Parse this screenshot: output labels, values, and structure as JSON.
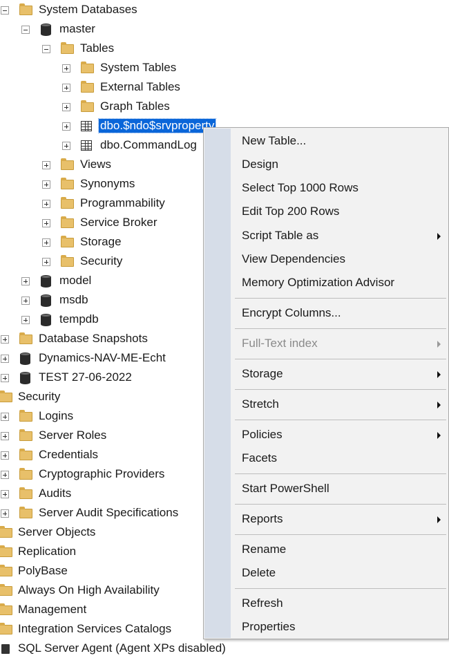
{
  "tree": {
    "nodes": [
      {
        "label": "System Databases",
        "icon": "folder-icon",
        "expander": "minus"
      },
      {
        "label": "master",
        "icon": "database-icon",
        "expander": "minus"
      },
      {
        "label": "Tables",
        "icon": "folder-icon",
        "expander": "minus"
      },
      {
        "label": "System Tables",
        "icon": "folder-icon",
        "expander": "plus"
      },
      {
        "label": "External Tables",
        "icon": "folder-icon",
        "expander": "plus"
      },
      {
        "label": "Graph Tables",
        "icon": "folder-icon",
        "expander": "plus"
      },
      {
        "label": "dbo.$ndo$srvproperty",
        "icon": "table-icon",
        "expander": "plus",
        "selected": true
      },
      {
        "label": "dbo.CommandLog",
        "icon": "table-icon",
        "expander": "plus"
      },
      {
        "label": "Views",
        "icon": "folder-icon",
        "expander": "plus"
      },
      {
        "label": "Synonyms",
        "icon": "folder-icon",
        "expander": "plus"
      },
      {
        "label": "Programmability",
        "icon": "folder-icon",
        "expander": "plus"
      },
      {
        "label": "Service Broker",
        "icon": "folder-icon",
        "expander": "plus"
      },
      {
        "label": "Storage",
        "icon": "folder-icon",
        "expander": "plus"
      },
      {
        "label": "Security",
        "icon": "folder-icon",
        "expander": "plus"
      },
      {
        "label": "model",
        "icon": "database-icon",
        "expander": "plus"
      },
      {
        "label": "msdb",
        "icon": "database-icon",
        "expander": "plus"
      },
      {
        "label": "tempdb",
        "icon": "database-icon",
        "expander": "plus"
      },
      {
        "label": "Database Snapshots",
        "icon": "folder-icon",
        "expander": "plus"
      },
      {
        "label": "Dynamics-NAV-ME-Echt",
        "icon": "database-icon",
        "expander": "plus"
      },
      {
        "label": "TEST 27-06-2022",
        "icon": "database-icon",
        "expander": "plus"
      },
      {
        "label": "Security",
        "icon": "folder-icon",
        "expander": "none"
      },
      {
        "label": "Logins",
        "icon": "folder-icon",
        "expander": "plus"
      },
      {
        "label": "Server Roles",
        "icon": "folder-icon",
        "expander": "plus"
      },
      {
        "label": "Credentials",
        "icon": "folder-icon",
        "expander": "plus"
      },
      {
        "label": "Cryptographic Providers",
        "icon": "folder-icon",
        "expander": "plus"
      },
      {
        "label": "Audits",
        "icon": "folder-icon",
        "expander": "plus"
      },
      {
        "label": "Server Audit Specifications",
        "icon": "folder-icon",
        "expander": "plus"
      },
      {
        "label": "Server Objects",
        "icon": "folder-icon",
        "expander": "none"
      },
      {
        "label": "Replication",
        "icon": "folder-icon",
        "expander": "none"
      },
      {
        "label": "PolyBase",
        "icon": "folder-icon",
        "expander": "none"
      },
      {
        "label": "Always On High Availability",
        "icon": "folder-icon",
        "expander": "none"
      },
      {
        "label": "Management",
        "icon": "folder-icon",
        "expander": "none"
      },
      {
        "label": "Integration Services Catalogs",
        "icon": "folder-icon",
        "expander": "none"
      },
      {
        "label": "SQL Server Agent (Agent XPs disabled)",
        "icon": "server-agent-icon",
        "expander": "none"
      }
    ]
  },
  "context_menu": {
    "items": [
      {
        "label": "New Table...",
        "submenu": false,
        "disabled": false
      },
      {
        "label": "Design",
        "submenu": false,
        "disabled": false
      },
      {
        "label": "Select Top 1000 Rows",
        "submenu": false,
        "disabled": false
      },
      {
        "label": "Edit Top 200 Rows",
        "submenu": false,
        "disabled": false
      },
      {
        "label": "Script Table as",
        "submenu": true,
        "disabled": false
      },
      {
        "label": "View Dependencies",
        "submenu": false,
        "disabled": false
      },
      {
        "label": "Memory Optimization Advisor",
        "submenu": false,
        "disabled": false
      },
      {
        "label": "Encrypt Columns...",
        "submenu": false,
        "disabled": false
      },
      {
        "label": "Full-Text index",
        "submenu": true,
        "disabled": true
      },
      {
        "label": "Storage",
        "submenu": true,
        "disabled": false
      },
      {
        "label": "Stretch",
        "submenu": true,
        "disabled": false
      },
      {
        "label": "Policies",
        "submenu": true,
        "disabled": false
      },
      {
        "label": "Facets",
        "submenu": false,
        "disabled": false
      },
      {
        "label": "Start PowerShell",
        "submenu": false,
        "disabled": false
      },
      {
        "label": "Reports",
        "submenu": true,
        "disabled": false
      },
      {
        "label": "Rename",
        "submenu": false,
        "disabled": false
      },
      {
        "label": "Delete",
        "submenu": false,
        "disabled": false
      },
      {
        "label": "Refresh",
        "submenu": false,
        "disabled": false
      },
      {
        "label": "Properties",
        "submenu": false,
        "disabled": false
      }
    ]
  },
  "colors": {
    "selection": "#0a66d9",
    "menu_background": "#f2f2f2",
    "menu_gutter": "#d6dde8",
    "folder": "#e8c06a"
  }
}
